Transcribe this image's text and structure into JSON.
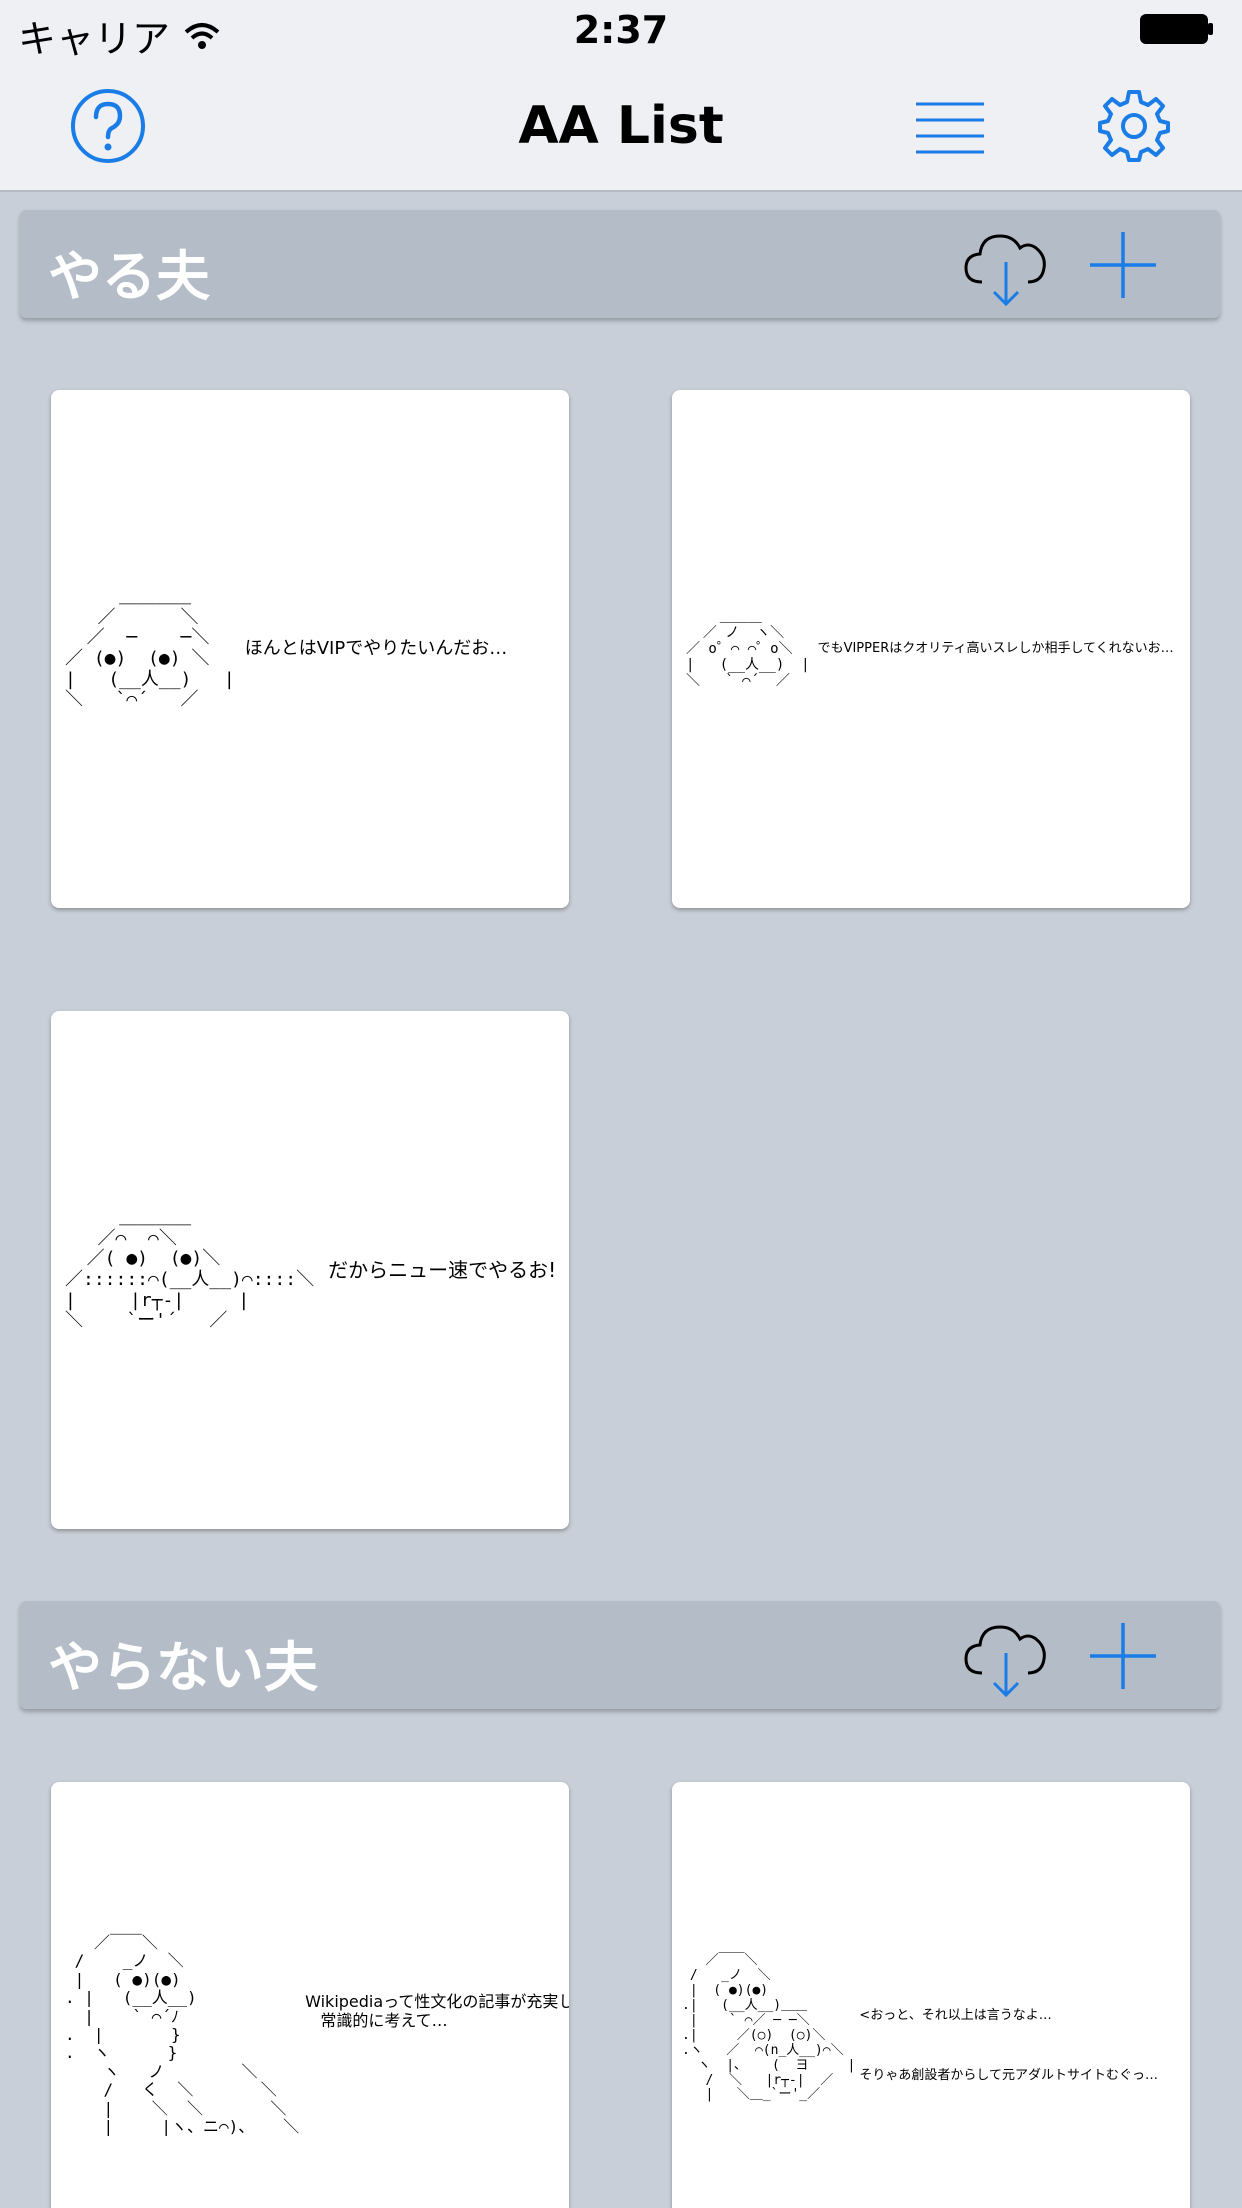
{
  "status_bar": {
    "carrier": "キャリア",
    "time": "2:37"
  },
  "nav": {
    "title": "AA List",
    "help_icon": "question-circle-icon",
    "menu_icon": "list-icon",
    "settings_icon": "gear-icon"
  },
  "colors": {
    "accent": "#1a7ce6",
    "section_bg": "#b4bcc8",
    "page_bg": "#c9cfd8",
    "nav_bg": "#eef0f3"
  },
  "sections": [
    {
      "title": "やる夫",
      "download_icon": "cloud-download-icon",
      "add_icon": "plus-icon",
      "items": [
        {
          "art": "     ＿＿＿＿\n   ／      ＼\n  ／  ─    ─＼\n／ (●)  (●) ＼\n|   (__人__)   |\n＼   `⌒´   ／",
          "caption": "ほんとはVIPでやりたいんだお…"
        },
        {
          "art": "    ＿＿＿\n  ／ ノ  ヽ＼\n／ o゜⌒ ⌒゜o＼\n|   (__人__)  |\n＼   ` ⌒´  ／",
          "caption": "でもVIPPERはクオリティ高いスレしか相手してくれないお…"
        },
        {
          "art": "     ＿＿＿＿\n   ／⌒  ⌒＼\n  ／( ●)  (●)＼\n／::::::⌒(__人__)⌒::::＼\n|     |r┬-|     |\n＼    `ー'´   ／",
          "caption": "だからニュー速でやるお!"
        }
      ]
    },
    {
      "title": "やらない夫",
      "download_icon": "cloud-download-icon",
      "add_icon": "plus-icon",
      "items": [
        {
          "art": "   ／￣￣＼\n /    _ノ  ＼\n |   ( ●)(●)\n. |   (__人__)\n  |    ` ⌒´ﾉ\n.  |       }\n.  ヽ      }\n    ヽ   ノ        ＼\n    /   く  ＼       ＼\n    |    ＼  ＼       ＼\n    |     |ヽ、ニ⌒)、   ＼",
          "caption": "Wikipediaって性文化の記事が充実しすぎだろ…\n   常識的に考えて…"
        },
        {
          "art": "   ／￣￣＼\n /   _ノ  ＼\n |  ( ●)(●)\n.|   (__人__)＿＿\n |    ` ⌒／ ─ ─＼\n.|     ／(○)  (○)＼\n.ヽ   ／  ⌒(n_人__)⌒＼\n  ヽ  |､    (  ヨ     |\n   /  ＼   |r┬-|  ／\n   |   ＼＿_`ー'_／",
          "caption": "<おっと、それ以上は言うなよ…\nそりゃあ創設者からして元アダルトサイトむぐっ…"
        }
      ]
    }
  ]
}
